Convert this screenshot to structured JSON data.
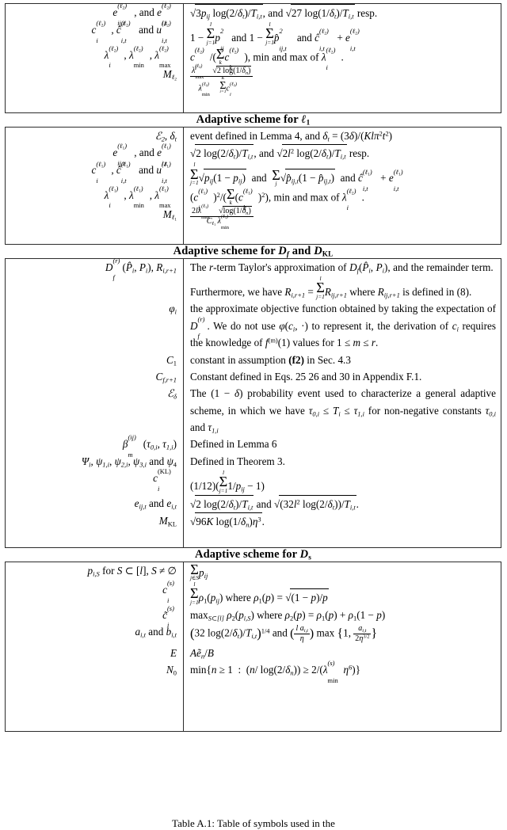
{
  "document": {
    "type": "academic-paper-table",
    "caption": "Table A.1: Table of symbols used in the"
  },
  "sections": [
    {
      "id": "l2-continued",
      "header": null,
      "rows": [
        {
          "symbol": "e_{ij,t}^{(ℓ2)}, and e_{i,t}^{(ℓ2)}",
          "definition": "√(3p_ij log(2/δ_t)/T_{i,t}), and √(27 log(1/δ_t)/T_{i,t}) resp."
        },
        {
          "symbol": "c_i^{(ℓ2)}, ĉ_{i,t}^{(ℓ2)} and u_{i,t}^{(ℓ2)}",
          "definition": "1 − Σ_{j=1}^{l} p_{ij}^2 and 1 − Σ_{j=1}^{l} p̂_{ij,t}^2 and ĉ_{i,t}^{(ℓ2)} + e_{i,t}^{(ℓ2)}"
        },
        {
          "symbol": "λ_i^{(ℓ2)}, λ_min^{(ℓ2)}, λ_max^{(ℓ2)}",
          "definition": "c_i^{(ℓ2)}/(Σ_k c_k^{(ℓ2)}), min and max of λ_i^{(ℓ2)}."
        },
        {
          "symbol": "M_{ℓ2}",
          "definition": "λ_max^{(ℓ2)} √(2 log(1/δ_n)) / (λ_min^{(ℓ2)} Σ_{i=1}^{K} c_i^{(ℓ2)})"
        }
      ]
    },
    {
      "id": "l1",
      "header": "Adaptive scheme for ℓ1",
      "rows": [
        {
          "symbol": "ℰ_2, δ_t",
          "definition": "event defined in Lemma 4, and δ_t = (3δ)/(Klπ²t²)"
        },
        {
          "symbol": "e_{ij,t}^{(ℓ1)}, and e_{i,t}^{(ℓ1)}",
          "definition": "√(2 log(2/δ_t)/T_{i,t}), and √(2l² log(2/δ_t)/T_{i,t}) resp."
        },
        {
          "symbol": "c_i^{(ℓ1)}, ĉ_{i,t}^{(ℓ1)} and u_{i,t}^{(ℓ1)}",
          "definition": "Σ_{j=1}^{l} √(p_{ij}(1−p_{ij})) and Σ_j √(p̂_{ij,t}(1−p̂_{ij,t})) and ĉ_{i,t}^{(ℓ1)} + e_{i,t}^{(ℓ1)}"
        },
        {
          "symbol": "λ_i^{(ℓ1)}, λ_min^{(ℓ1)}, λ_max^{(ℓ1)}",
          "definition": "(c_i^{(ℓ1)})²/(Σ_k (c_k^{(ℓ1)})²), min and max of λ_i^{(ℓ2)}."
        },
        {
          "symbol": "M_{ℓ1}",
          "definition": "2lλ_max^{(ℓ1)} √(log(1/δ_n)) / (C_{ℓ1} λ_min^{(ℓ1)})"
        }
      ]
    },
    {
      "id": "df-dkl",
      "header": "Adaptive scheme for D_f and D_KL",
      "rows": [
        {
          "symbol": "D_f^{(r)}(P̂_i, P_i), R_{i,r+1}",
          "definition": "The r-term Taylor's approximation of D_f(P̂_i, P_i), and the remainder term. Furthermore, we have R_{i,r+1} = Σ_{j=1}^{l} R_{ij,r+1} where R_{ij,r+1} is defined in (8)."
        },
        {
          "symbol": "φ_i",
          "definition": "the approximate objective function obtained by taking the expectation of D_f^{(r)}. We do not use φ(c_i, ·) to represent it, the derivation of c_i requires the knowledge of f^{(m)}(1) values for 1 ≤ m ≤ r."
        },
        {
          "symbol": "C_1",
          "definition": "constant in assumption (f2) in Sec. 4.3"
        },
        {
          "symbol": "C_{f,r+1}",
          "definition": "Constant defined in Eqs. 25 26 and 30 in Appendix F.1."
        },
        {
          "symbol": "ℰ_δ",
          "definition": "The (1 − δ) probability event used to characterize a general adaptive scheme, in which we have τ_{0,i} ≤ T_i ≤ τ_{1,i} for non-negative constants τ_{0,i} and τ_{1,i}"
        },
        {
          "symbol": "β_m^{(ij)} (τ_{0,i}, τ_{1,i})",
          "definition": "Defined in Lemma 6"
        },
        {
          "symbol": "Ψ_i, ψ_{1,i}, ψ_{2,i}, ψ_{3,i} and ψ_4",
          "definition": "Defined in Theorem 3."
        },
        {
          "symbol": "c_i^{(KL)}",
          "definition": "(1/12)(Σ_{j=1}^{l} 1/p_{ij} − 1)"
        },
        {
          "symbol": "e_{ij,t} and e_{i,t}",
          "definition": "√(2 log(2/δ_t)/T_{i,t}) and √((32l² log(2/δ_t))/T_{i,t})."
        },
        {
          "symbol": "M_KL",
          "definition": "√(96K log(1/δ_n)η³)."
        }
      ]
    },
    {
      "id": "ds",
      "header": "Adaptive scheme for D_s",
      "rows": [
        {
          "symbol": "p_{i,S} for S ⊂ [l], S ≠ ∅",
          "definition": "Σ_{j∈S} p_{ij}"
        },
        {
          "symbol": "c_i^{(s)}",
          "definition": "Σ_{j=1}^{l} ρ_1(p_{ij}) where ρ_1(p) = √((1−p)/p)"
        },
        {
          "symbol": "c̃_i^{(s)}",
          "definition": "max_{S⊂[l]} ρ_2(p_{i,S}) where ρ_2(p) = ρ_1(p) + ρ_1(1−p)"
        },
        {
          "symbol": "a_{i,t} and b_{i,t}",
          "definition": "(32 log(2/δ_t)/T_{i,t})^{1/4} and (l a_{i,t}/η) max{1, a_{i,t}/(2η^{3/2})}"
        },
        {
          "symbol": "E",
          "definition": "Aẽ_n/B"
        },
        {
          "symbol": "N_0",
          "definition": "min{n ≥ 1 : (n/ log(2/δ_n)) ≥ 2/(λ_min^{(s)}η⁶)}"
        }
      ]
    }
  ],
  "section_headers": {
    "l1": "Adaptive scheme for",
    "df": "Adaptive scheme for",
    "ds": "Adaptive scheme for",
    "and": "and"
  },
  "labels": {
    "resp": "resp.",
    "and": "and",
    "min_and_max_of": "min and max of",
    "event_defined": "event defined in Lemma 4, and",
    "taylor_1": "The",
    "taylor_2": "-term Taylor's approximation of",
    "taylor_3": "and the remainder term.  Furthermore, we have",
    "taylor_4": "where",
    "taylor_5": "is defined in (8).",
    "phi_1": "the approximate objective function obtained by taking the expectation of",
    "phi_2": ". We do not use",
    "phi_3": "to represent it, the derivation of",
    "phi_4": "requires the knowledge of",
    "phi_5": "values for",
    "c1_def": "constant in assumption",
    "c1_def2": "in Sec. 4.3",
    "cfr_def": "Constant defined in Eqs. 25 26 and 30 in Appendix F.1.",
    "edelta_1": "The",
    "edelta_2": "probability event used to characterize a general adaptive scheme, in which we have",
    "edelta_3": "for non-negative constants",
    "beta_def": "Defined in Lemma 6",
    "psi_def": "Defined in Theorem 3.",
    "where": "where",
    "max_prefix": "max",
    "f2_bold": "(f2)"
  },
  "colors": {
    "ink": "#000000",
    "rule": "#2b2b2b",
    "page": "#ffffff"
  }
}
